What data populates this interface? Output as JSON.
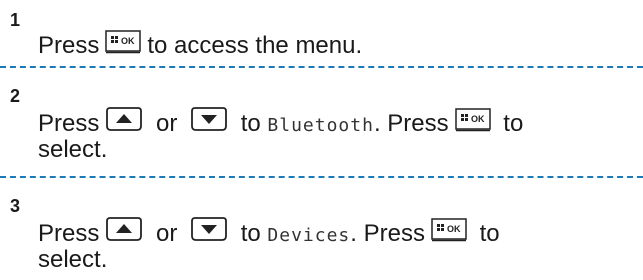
{
  "steps": [
    {
      "number": "1",
      "line1": {
        "a": "Press",
        "b": "to access the menu."
      }
    },
    {
      "number": "2",
      "line1": {
        "a": "Press",
        "or": "or",
        "to": "to",
        "target": "Bluetooth",
        "press2": ". Press",
        "tail": "to"
      },
      "line2": "select."
    },
    {
      "number": "3",
      "line1": {
        "a": "Press",
        "or": "or",
        "to": "to",
        "target": "Devices",
        "press2": ". Press",
        "tail": "to"
      },
      "line2": "select."
    }
  ],
  "keys": {
    "ok_label": "OK",
    "up_icon": "up-arrow-key-icon",
    "down_icon": "down-arrow-key-icon",
    "menu_ok_icon": "menu-ok-key-icon"
  },
  "colors": {
    "divider": "#1c7bb7",
    "text": "#1a1a1a"
  }
}
